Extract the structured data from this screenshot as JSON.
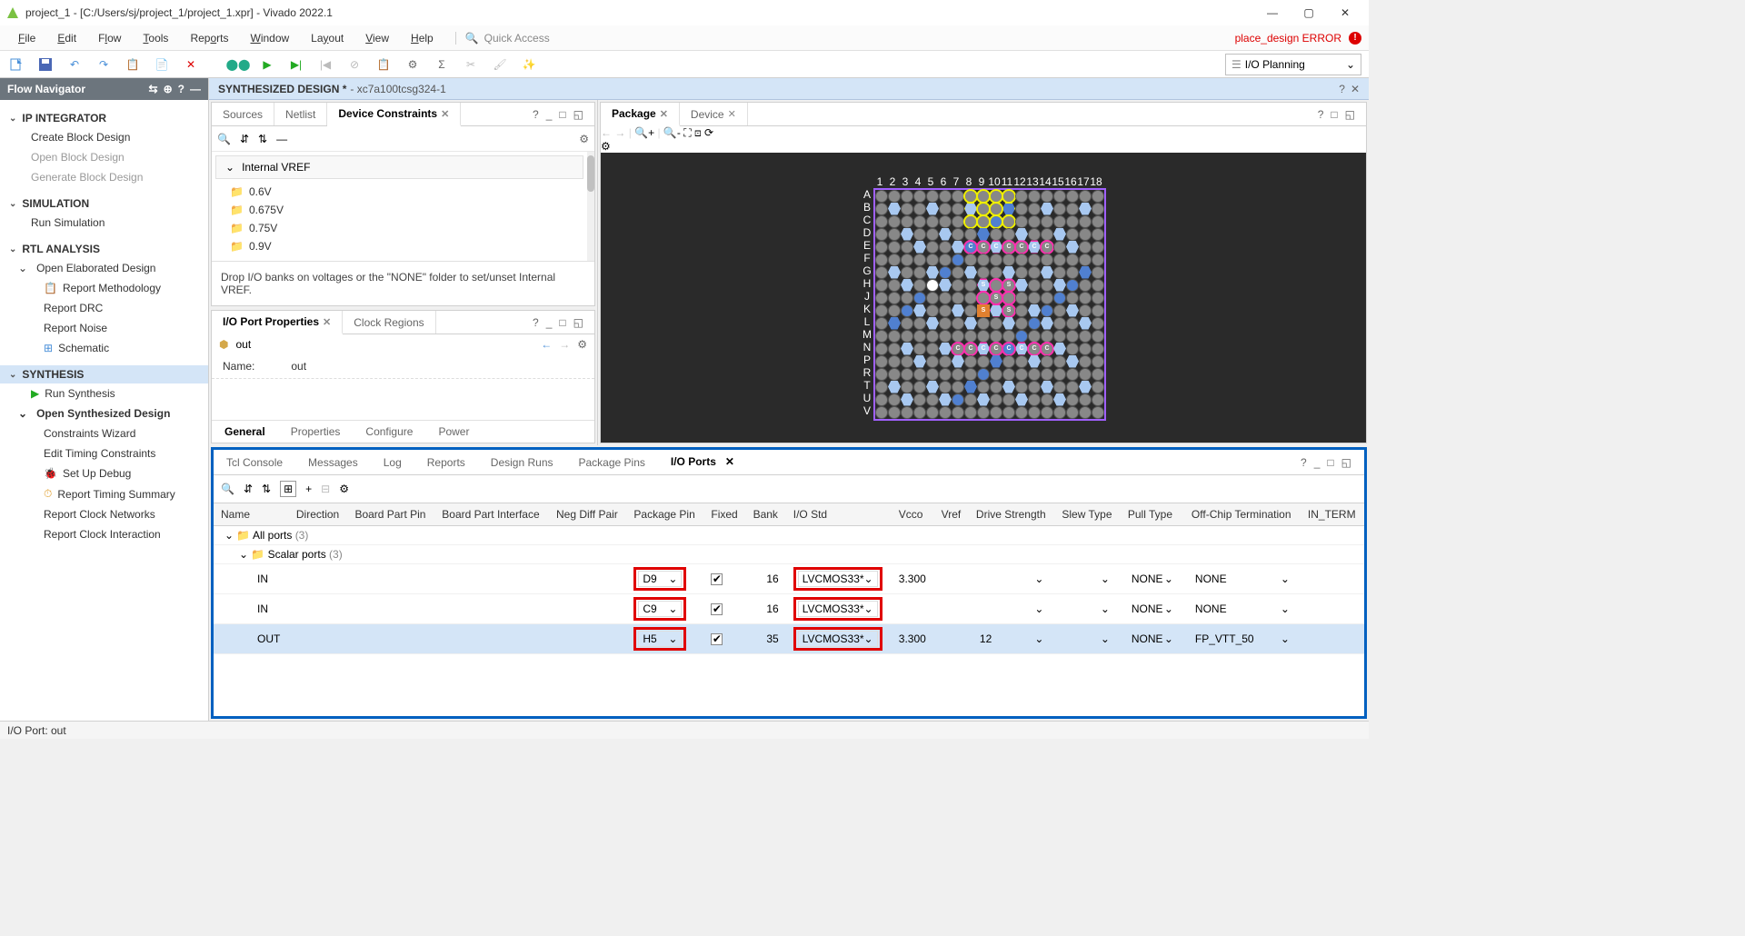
{
  "titlebar": {
    "title": "project_1 - [C:/Users/sj/project_1/project_1.xpr] - Vivado 2022.1"
  },
  "menubar": {
    "items": [
      "File",
      "Edit",
      "Flow",
      "Tools",
      "Reports",
      "Window",
      "Layout",
      "View",
      "Help"
    ],
    "quick_access": "Quick Access",
    "error": "place_design ERROR"
  },
  "toolbar": {
    "mode_selector": "I/O Planning"
  },
  "flownav": {
    "title": "Flow Navigator",
    "sections": {
      "ip_integrator": {
        "label": "IP INTEGRATOR",
        "items": [
          "Create Block Design",
          "Open Block Design",
          "Generate Block Design"
        ]
      },
      "simulation": {
        "label": "SIMULATION",
        "items": [
          "Run Simulation"
        ]
      },
      "rtl_analysis": {
        "label": "RTL ANALYSIS",
        "open_label": "Open Elaborated Design",
        "items": [
          "Report Methodology",
          "Report DRC",
          "Report Noise",
          "Schematic"
        ]
      },
      "synthesis": {
        "label": "SYNTHESIS",
        "run": "Run Synthesis",
        "open_label": "Open Synthesized Design",
        "items": [
          "Constraints Wizard",
          "Edit Timing Constraints",
          "Set Up Debug",
          "Report Timing Summary",
          "Report Clock Networks",
          "Report Clock Interaction"
        ]
      }
    }
  },
  "design_header": {
    "title": "SYNTHESIZED DESIGN *",
    "subtitle": "- xc7a100tcsg324-1"
  },
  "dev_constraints": {
    "tabs": [
      "Sources",
      "Netlist",
      "Device Constraints"
    ],
    "vref_label": "Internal VREF",
    "voltages": [
      "0.6V",
      "0.675V",
      "0.75V",
      "0.9V"
    ],
    "help": "Drop I/O banks on voltages or the \"NONE\" folder to set/unset Internal VREF."
  },
  "port_props": {
    "tabs": [
      "I/O Port Properties",
      "Clock Regions"
    ],
    "port_name": "out",
    "name_label": "Name:",
    "name_value": "out",
    "subtabs": [
      "General",
      "Properties",
      "Configure",
      "Power"
    ]
  },
  "package_panel": {
    "tabs": [
      "Package",
      "Device"
    ],
    "cols": [
      "1",
      "2",
      "3",
      "4",
      "5",
      "6",
      "7",
      "8",
      "9",
      "10",
      "11",
      "12",
      "13",
      "14",
      "15",
      "16",
      "17",
      "18"
    ],
    "rows": [
      "A",
      "B",
      "C",
      "D",
      "E",
      "F",
      "G",
      "H",
      "J",
      "K",
      "L",
      "M",
      "N",
      "P",
      "R",
      "T",
      "U",
      "V"
    ]
  },
  "bottom_panel": {
    "tabs": [
      "Tcl Console",
      "Messages",
      "Log",
      "Reports",
      "Design Runs",
      "Package Pins",
      "I/O Ports"
    ],
    "columns": [
      "Name",
      "Direction",
      "Board Part Pin",
      "Board Part Interface",
      "Neg Diff Pair",
      "Package Pin",
      "Fixed",
      "Bank",
      "I/O Std",
      "Vcco",
      "Vref",
      "Drive Strength",
      "Slew Type",
      "Pull Type",
      "Off-Chip Termination",
      "IN_TERM"
    ],
    "all_ports": "All ports",
    "all_ports_count": "(3)",
    "scalar_ports": "Scalar ports",
    "scalar_ports_count": "(3)",
    "rows": [
      {
        "name": "IN",
        "pkg": "D9",
        "fixed": true,
        "bank": "16",
        "iostd": "LVCMOS33*",
        "vcco": "3.300",
        "drive": "",
        "pull": "NONE",
        "off": "NONE"
      },
      {
        "name": "IN",
        "pkg": "C9",
        "fixed": true,
        "bank": "16",
        "iostd": "LVCMOS33*",
        "vcco": "",
        "drive": "",
        "pull": "NONE",
        "off": "NONE"
      },
      {
        "name": "OUT",
        "pkg": "H5",
        "fixed": true,
        "bank": "35",
        "iostd": "LVCMOS33*",
        "vcco": "3.300",
        "drive": "12",
        "pull": "NONE",
        "off": "FP_VTT_50"
      }
    ]
  },
  "statusbar": {
    "text": "I/O Port: out"
  }
}
